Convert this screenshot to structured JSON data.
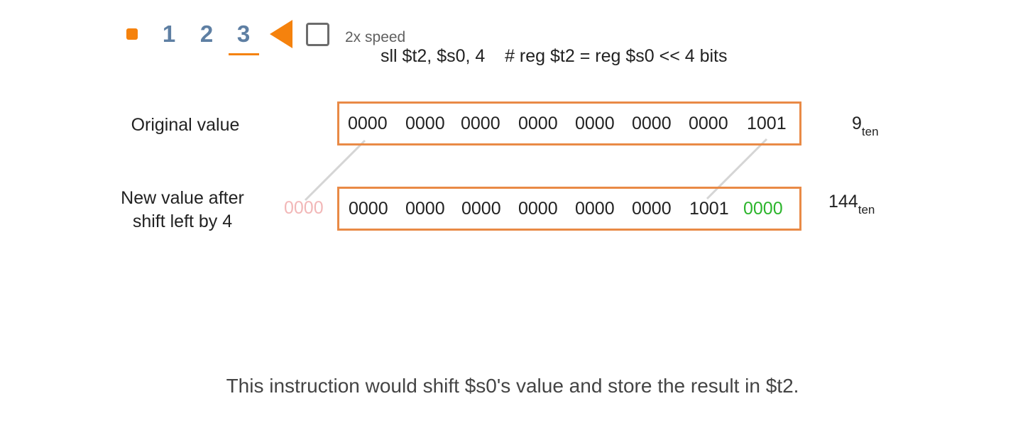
{
  "controls": {
    "steps": [
      "1",
      "2",
      "3"
    ],
    "active_step": "3",
    "speed_label": "2x speed",
    "speed_checked": false,
    "accent_color": "#f5820d",
    "step_color": "#5e7fa3",
    "icons": {
      "stop": "stop-square-icon",
      "back": "back-triangle-icon",
      "speed": "checkbox-icon"
    }
  },
  "instruction": "sll $t2, $s0, 4    # reg $t2 = reg $s0 << 4 bits",
  "original": {
    "label": "Original value",
    "nibbles": [
      "0000",
      "0000",
      "0000",
      "0000",
      "0000",
      "0000",
      "0000",
      "1001"
    ],
    "decimal": "9",
    "base": "ten"
  },
  "shifted": {
    "label_line1": "New value after",
    "label_line2": "shift left by 4",
    "shifted_out": "0000",
    "nibbles": [
      "0000",
      "0000",
      "0000",
      "0000",
      "0000",
      "0000",
      "1001",
      "0000"
    ],
    "decimal": "144",
    "base": "ten",
    "shifted_in_color": "#2cb52c",
    "shifted_out_color": "#f2b7b7"
  },
  "register_border_color": "#e98a46",
  "caption": "This instruction would shift $s0's value and store the result in $t2."
}
